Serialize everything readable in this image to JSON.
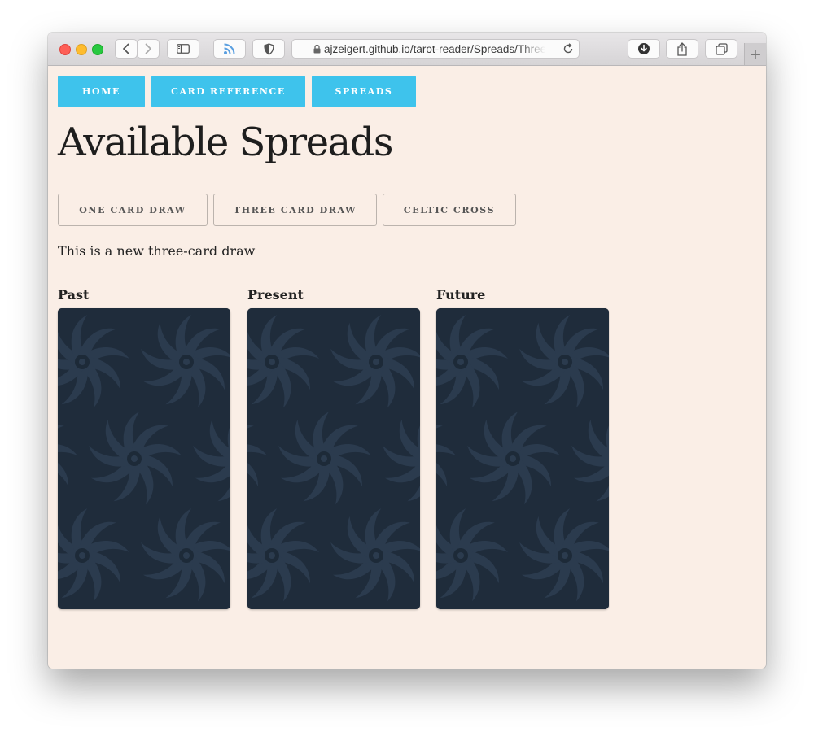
{
  "browser": {
    "url": "ajzeigert.github.io/tarot-reader/Spreads/ThreeCardDraw"
  },
  "nav": {
    "home": "HOME",
    "card_reference": "CARD REFERENCE",
    "spreads": "SPREADS"
  },
  "page": {
    "title": "Available Spreads",
    "description": "This is a new three-card draw"
  },
  "spread_buttons": {
    "one_card": "ONE CARD DRAW",
    "three_card": "THREE CARD DRAW",
    "celtic_cross": "CELTIC CROSS"
  },
  "cards": [
    {
      "label": "Past"
    },
    {
      "label": "Present"
    },
    {
      "label": "Future"
    }
  ],
  "colors": {
    "nav_accent": "#3ec3ec",
    "page_background": "#faeee6",
    "card_back": "#1f2c3b"
  }
}
